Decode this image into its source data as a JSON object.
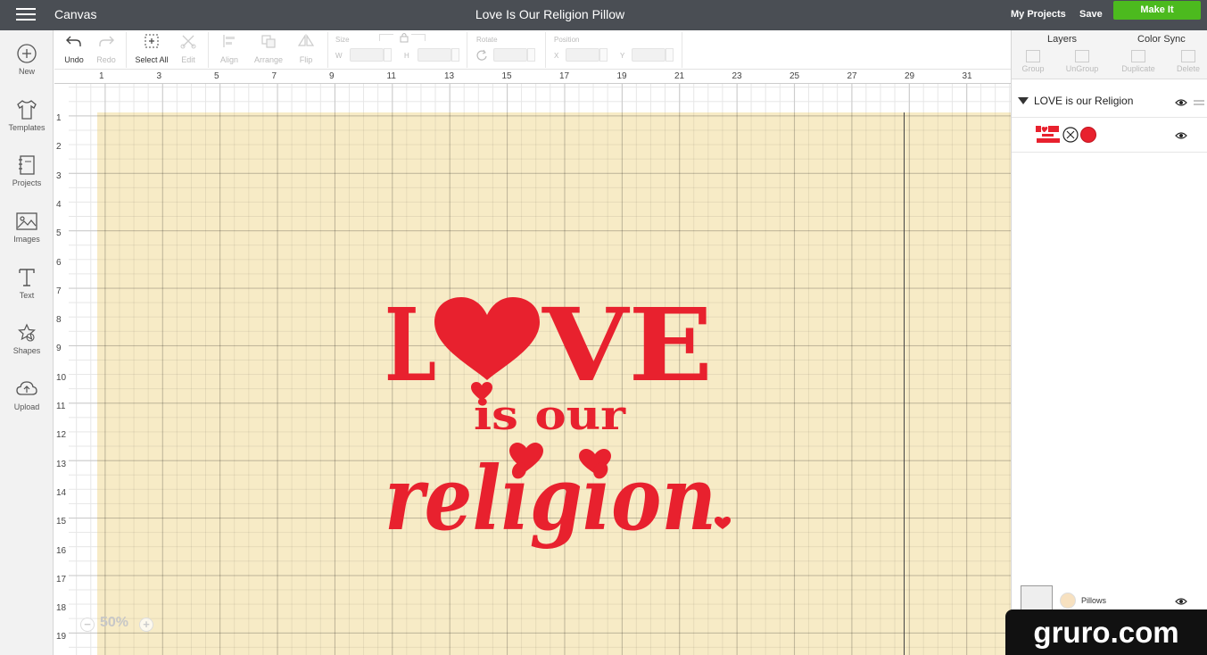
{
  "topbar": {
    "menu_icon": "hamburger-icon",
    "app_title": "Canvas",
    "project_title": "Love Is Our Religion Pillow",
    "my_projects": "My Projects",
    "save": "Save",
    "make_it": "Make It",
    "make_it_color": "#4cba1e"
  },
  "sidebar": {
    "items": [
      {
        "label": "New",
        "icon": "plus-circle-icon"
      },
      {
        "label": "Templates",
        "icon": "tshirt-icon"
      },
      {
        "label": "Projects",
        "icon": "notebook-icon"
      },
      {
        "label": "Images",
        "icon": "image-icon"
      },
      {
        "label": "Text",
        "icon": "text-icon"
      },
      {
        "label": "Shapes",
        "icon": "shapes-icon"
      },
      {
        "label": "Upload",
        "icon": "cloud-upload-icon"
      }
    ]
  },
  "toolbar": {
    "undo": "Undo",
    "redo": "Redo",
    "select_all": "Select All",
    "edit": "Edit",
    "align": "Align",
    "arrange": "Arrange",
    "flip": "Flip",
    "size": "Size",
    "w": "W",
    "h": "H",
    "rotate": "Rotate",
    "position": "Position",
    "x": "X",
    "y": "Y"
  },
  "rulers": {
    "top": [
      "1",
      "3",
      "5",
      "7",
      "9",
      "11",
      "13",
      "15",
      "17",
      "19",
      "21",
      "23",
      "25",
      "27",
      "29",
      "31"
    ],
    "left": [
      "1",
      "2",
      "3",
      "4",
      "5",
      "6",
      "7",
      "8",
      "9",
      "10",
      "11",
      "12",
      "13",
      "14",
      "15",
      "16",
      "17",
      "18",
      "19"
    ]
  },
  "design": {
    "line1": "L",
    "line1_rest": "VE",
    "line2": "is our",
    "line3": "religion",
    "color": "#e8212e",
    "mat_color": "#f7ebc6"
  },
  "zoom": {
    "level": "50%"
  },
  "layers_panel": {
    "tab_layers": "Layers",
    "tab_color_sync": "Color Sync",
    "actions": [
      "Group",
      "UnGroup",
      "Duplicate",
      "Delete"
    ],
    "group_name": "LOVE is our Religion",
    "layer_color": "#e8212e",
    "bottom_layer_name": "Pillows",
    "bottom_layer_color": "#f7e1c0"
  },
  "watermark": "gruro.com"
}
